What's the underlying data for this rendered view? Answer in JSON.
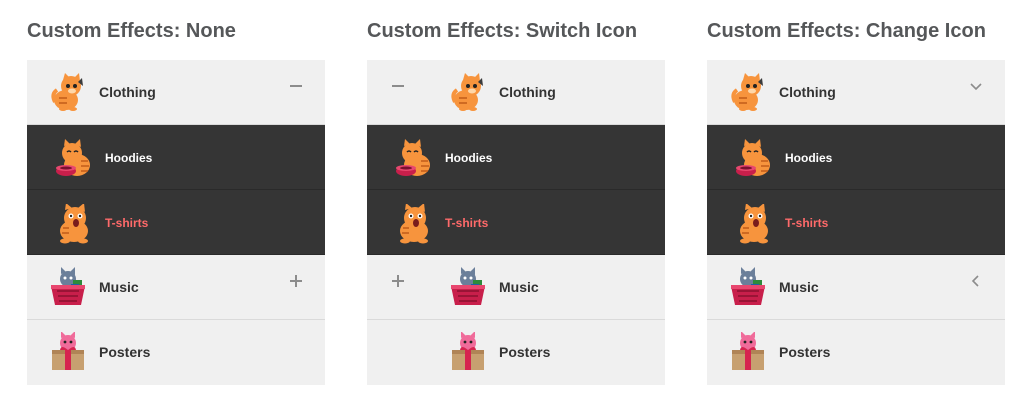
{
  "colors": {
    "title": "#555759",
    "top_bg": "#f0f0f0",
    "sub_bg": "#353535",
    "active_text": "#ff6a6a",
    "indicator": "#8c8c8c"
  },
  "panels": [
    {
      "title": "Custom Effects: None",
      "items": [
        {
          "label": "Clothing",
          "indicator": "minus-icon"
        },
        {
          "label": "Hoodies",
          "sub": true
        },
        {
          "label": "T-shirts",
          "sub": true,
          "active": true
        },
        {
          "label": "Music",
          "indicator": "plus-icon"
        },
        {
          "label": "Posters"
        }
      ]
    },
    {
      "title": "Custom Effects: Switch Icon",
      "items": [
        {
          "label": "Clothing",
          "indicator": "minus-icon"
        },
        {
          "label": "Hoodies",
          "sub": true
        },
        {
          "label": "T-shirts",
          "sub": true,
          "active": true
        },
        {
          "label": "Music",
          "indicator": "plus-icon"
        },
        {
          "label": "Posters"
        }
      ]
    },
    {
      "title": "Custom Effects: Change Icon",
      "items": [
        {
          "label": "Clothing",
          "indicator": "chevron-down-icon"
        },
        {
          "label": "Hoodies",
          "sub": true
        },
        {
          "label": "T-shirts",
          "sub": true,
          "active": true
        },
        {
          "label": "Music",
          "indicator": "chevron-left-icon"
        },
        {
          "label": "Posters"
        }
      ]
    }
  ],
  "icons": {
    "clothing": "cat-sitting-icon",
    "hoodies": "cat-eating-icon",
    "tshirts": "cat-surprised-icon",
    "music": "cat-basket-icon",
    "posters": "cat-gift-icon"
  }
}
